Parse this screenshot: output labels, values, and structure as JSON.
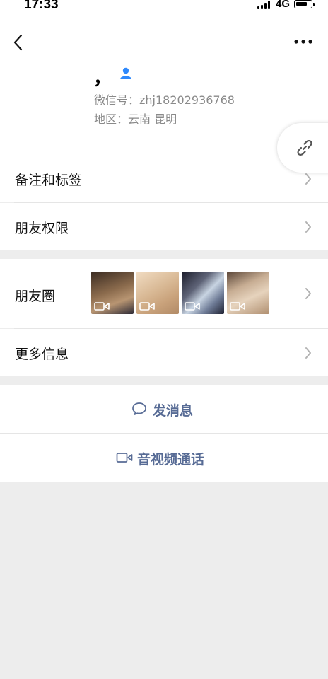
{
  "status_bar": {
    "time": "17:33",
    "network": "4G"
  },
  "header": {
    "back_icon": "chevron-left-icon",
    "more_icon": "more-dots-icon"
  },
  "profile": {
    "nickname": "，",
    "wechat_id": "微信号：zhj18202936768",
    "region": "地区：云南 昆明",
    "accent_color": "#2f89fc"
  },
  "menu": {
    "remarks_tags": "备注和标签",
    "friend_permissions": "朋友权限",
    "moments": "朋友圈",
    "more_info": "更多信息"
  },
  "moments_thumbnails": [
    {
      "type": "video"
    },
    {
      "type": "video"
    },
    {
      "type": "video"
    },
    {
      "type": "video"
    }
  ],
  "actions": {
    "send_message": "发消息",
    "video_call": "音视频通话",
    "link_color": "#576b95"
  }
}
